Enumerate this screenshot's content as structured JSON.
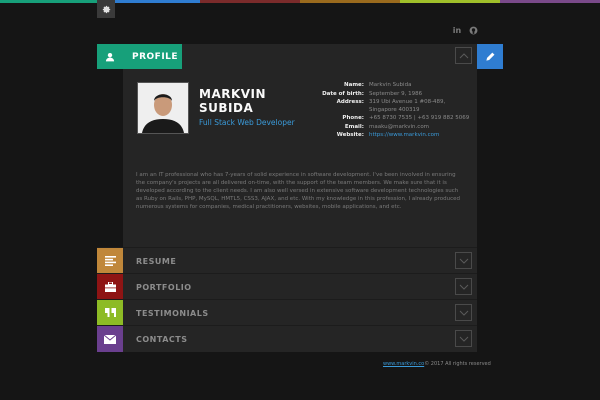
{
  "topbar_colors": [
    "#17a07a",
    "#2f7dd1",
    "#7b2b2b",
    "#9a6a1d",
    "#9fbf2a",
    "#7a4a8a"
  ],
  "social": {
    "linkedin": "in",
    "github": "github-icon"
  },
  "profile": {
    "tab_label": "PROFILE",
    "first_name": "MARKVIN",
    "last_name": "SUBIDA",
    "job_title": "Full Stack Web Developer",
    "details": [
      {
        "label": "Name:",
        "value": "Markvin Subida"
      },
      {
        "label": "Date of birth:",
        "value": "September 9, 1986"
      },
      {
        "label": "Address:",
        "value": "319 Ubi Avenue 1 #08-489, Singapore 400319"
      },
      {
        "label": "Phone:",
        "value": "+65 8730 7535 | +63 919 882 5069"
      },
      {
        "label": "Email:",
        "value": "maaku@markvin.com"
      },
      {
        "label": "Website:",
        "value": "https://www.markvin.com",
        "link": true
      }
    ],
    "bio": "I am an IT professional who has 7-years of solid experience in software development. I've been involved in ensuring the company's projects are all delivered on-time, with the support of the team members. We make sure that it is developed according to the client needs. I am also well versed in extensive software development technologies such as Ruby on Rails, PHP, MySQL, HMTL5, CSS3, AJAX, and etc. With my knowledge in this profession, I already produced numerous systems for companies, medical practitioners, websites, mobile applications, and etc."
  },
  "sections": [
    {
      "label": "RESUME",
      "color": "#c0873a"
    },
    {
      "label": "PORTFOLIO",
      "color": "#8e1414"
    },
    {
      "label": "TESTIMONIALS",
      "color": "#8dbb25"
    },
    {
      "label": "CONTACTS",
      "color": "#6a3f8e"
    }
  ],
  "footer": {
    "link_text": "www.markvin.co",
    "rest": "© 2017 All rights reserved"
  }
}
